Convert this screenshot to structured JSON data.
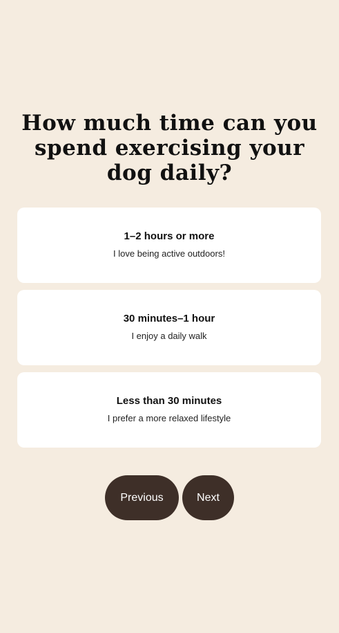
{
  "question": {
    "title": "How much time can you spend exercising your dog daily?"
  },
  "options": [
    {
      "title": "1–2 hours or more",
      "description": "I love being active outdoors!"
    },
    {
      "title": "30 minutes–1 hour",
      "description": "I enjoy a daily walk"
    },
    {
      "title": "Less than 30 minutes",
      "description": "I prefer a more relaxed lifestyle"
    }
  ],
  "navigation": {
    "previous_label": "Previous",
    "next_label": "Next"
  },
  "colors": {
    "background": "#f5ece0",
    "card": "#ffffff",
    "button": "#3e2f28",
    "button_text": "#ffffff"
  }
}
